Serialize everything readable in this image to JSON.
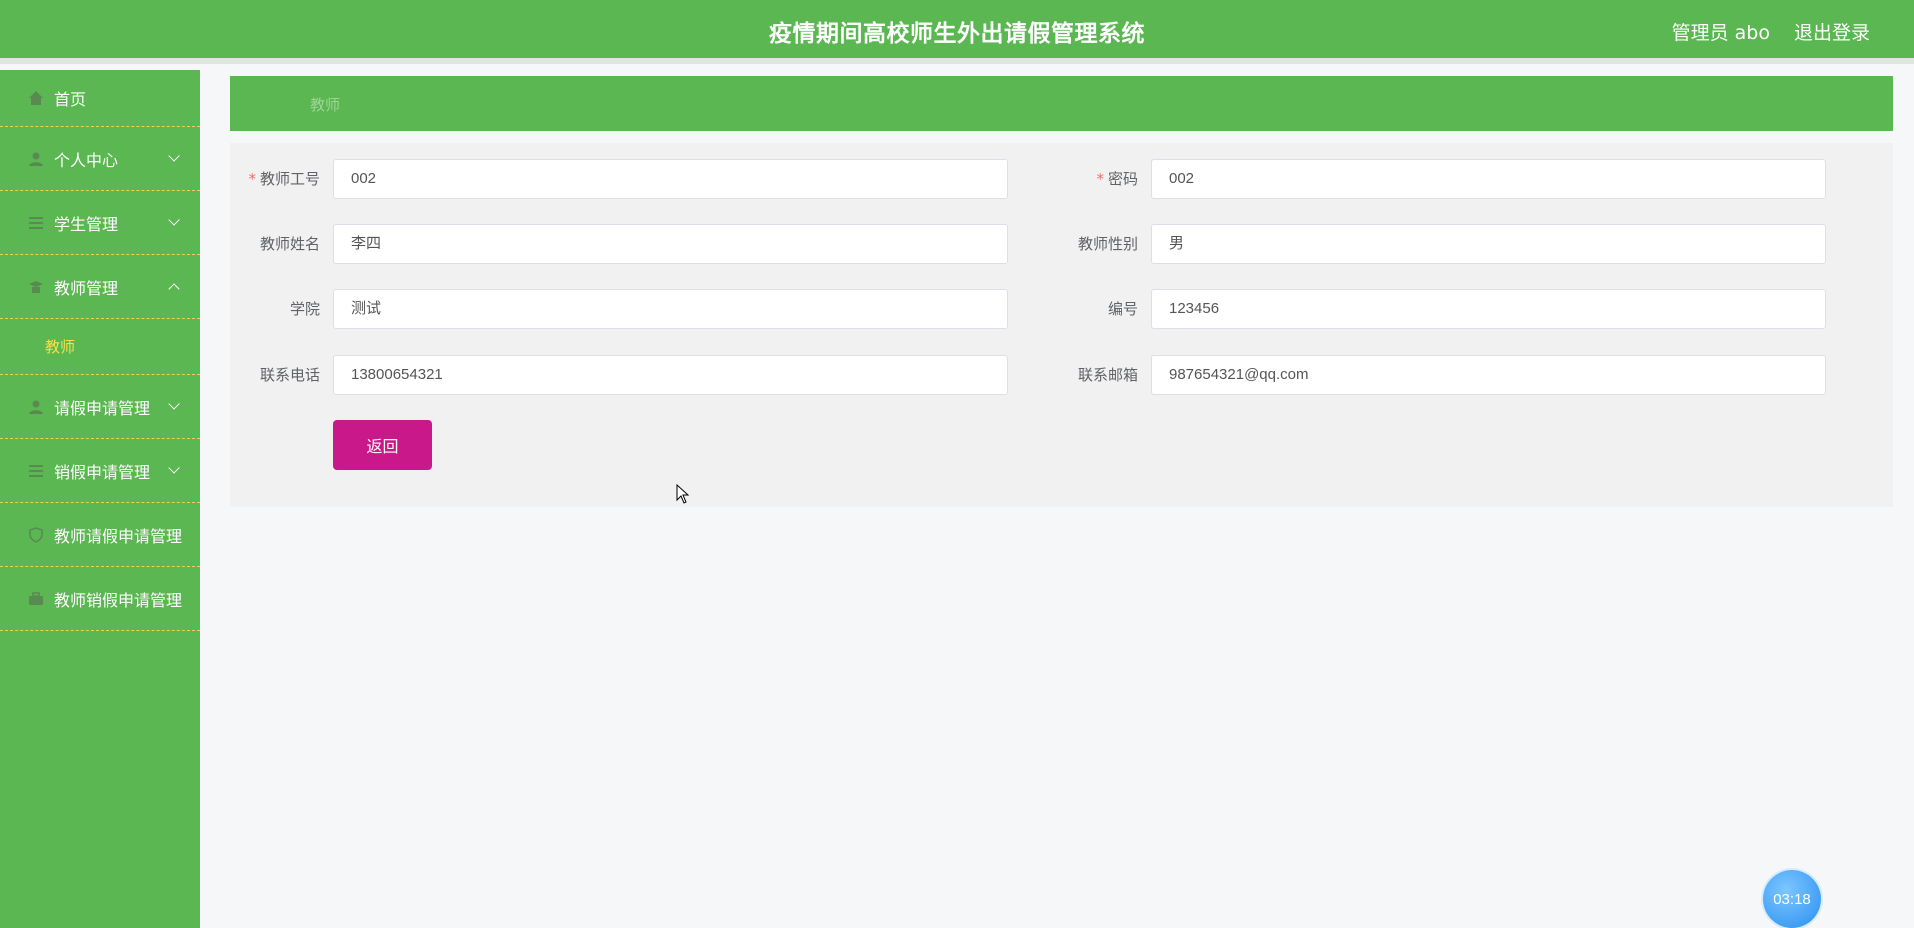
{
  "header": {
    "title": "疫情期间高校师生外出请假管理系统",
    "user": "管理员 abo",
    "logout": "退出登录"
  },
  "sidebar": {
    "items": [
      {
        "label": "首页",
        "icon": "home-icon"
      },
      {
        "label": "个人中心",
        "icon": "user-icon",
        "expandable": true
      },
      {
        "label": "学生管理",
        "icon": "list-icon",
        "expandable": true
      },
      {
        "label": "教师管理",
        "icon": "teacher-icon",
        "expandable": true,
        "expanded": true
      },
      {
        "label": "请假申请管理",
        "icon": "user-icon",
        "expandable": true
      },
      {
        "label": "销假申请管理",
        "icon": "list-icon",
        "expandable": true
      },
      {
        "label": "教师请假申请管理",
        "icon": "shield-icon"
      },
      {
        "label": "教师销假申请管理",
        "icon": "briefcase-icon"
      }
    ],
    "submenu": {
      "label": "教师"
    }
  },
  "breadcrumb": {
    "current": "教师"
  },
  "form": {
    "teacher_id": {
      "label": "教师工号",
      "value": "002",
      "required": true
    },
    "password": {
      "label": "密码",
      "value": "002",
      "required": true
    },
    "teacher_name": {
      "label": "教师姓名",
      "value": "李四"
    },
    "teacher_gender": {
      "label": "教师性别",
      "value": "男"
    },
    "college": {
      "label": "学院",
      "value": "测试"
    },
    "number": {
      "label": "编号",
      "value": "123456"
    },
    "phone": {
      "label": "联系电话",
      "value": "13800654321"
    },
    "email": {
      "label": "联系邮箱",
      "value": "987654321@qq.com"
    },
    "back_button": "返回"
  },
  "timer": {
    "value": "03:18"
  },
  "colors": {
    "primary_green": "#5bb751",
    "submenu_active": "#f5e14a",
    "back_button": "#c8188a",
    "required_star": "#f56c6c"
  }
}
